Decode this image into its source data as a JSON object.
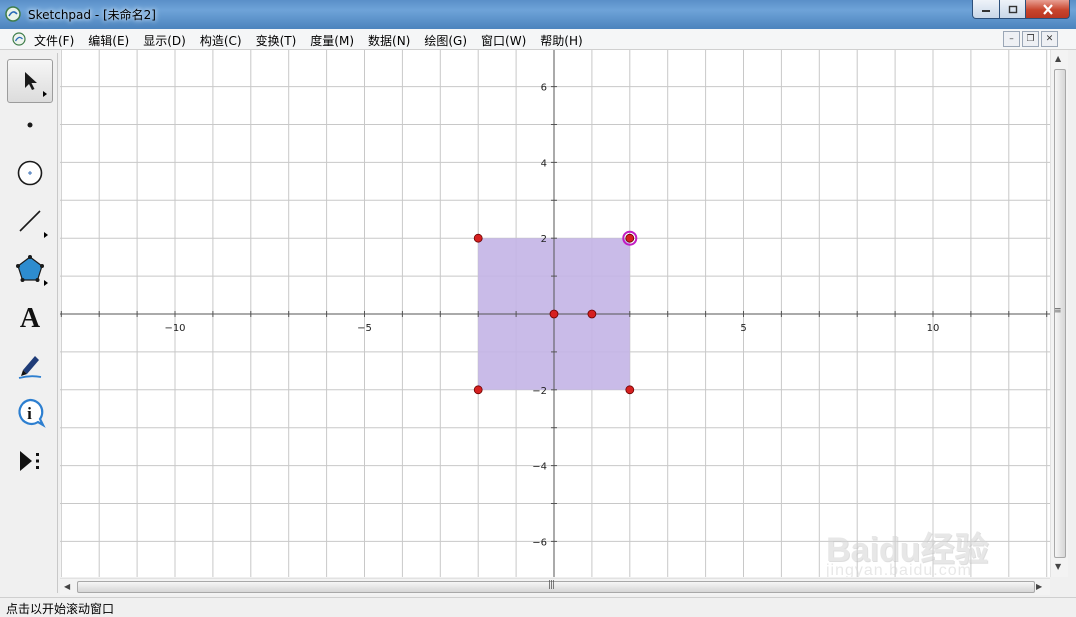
{
  "window": {
    "title": "Sketchpad  - [未命名2]"
  },
  "menu": {
    "items": [
      {
        "label": "文件(F)"
      },
      {
        "label": "编辑(E)"
      },
      {
        "label": "显示(D)"
      },
      {
        "label": "构造(C)"
      },
      {
        "label": "变换(T)"
      },
      {
        "label": "度量(M)"
      },
      {
        "label": "数据(N)"
      },
      {
        "label": "绘图(G)"
      },
      {
        "label": "窗口(W)"
      },
      {
        "label": "帮助(H)"
      }
    ]
  },
  "toolbox": {
    "tools": [
      {
        "name": "arrow-tool",
        "icon": "arrow-select-icon",
        "selected": true
      },
      {
        "name": "point-tool",
        "icon": "point-icon",
        "selected": false
      },
      {
        "name": "compass-tool",
        "icon": "circle-icon",
        "selected": false
      },
      {
        "name": "straightedge-tool",
        "icon": "line-segment-icon",
        "selected": false
      },
      {
        "name": "polygon-tool",
        "icon": "pentagon-icon",
        "selected": false
      },
      {
        "name": "text-tool",
        "icon": "text-a-icon",
        "selected": false
      },
      {
        "name": "marker-tool",
        "icon": "marker-pen-icon",
        "selected": false
      },
      {
        "name": "information-tool",
        "icon": "info-icon",
        "selected": false
      },
      {
        "name": "custom-tool",
        "icon": "play-custom-icon",
        "selected": false
      }
    ]
  },
  "graph": {
    "x_range": [
      -13,
      13
    ],
    "y_range": [
      -7,
      7
    ],
    "x_tick_labels": [
      {
        "value": -10,
        "label": "−10"
      },
      {
        "value": -5,
        "label": "−5"
      },
      {
        "value": 5,
        "label": "5"
      },
      {
        "value": 10,
        "label": "10"
      }
    ],
    "y_tick_labels": [
      {
        "value": 6,
        "label": "6"
      },
      {
        "value": 4,
        "label": "4"
      },
      {
        "value": 2,
        "label": "2"
      },
      {
        "value": -2,
        "label": "−2"
      },
      {
        "value": -4,
        "label": "−4"
      },
      {
        "value": -6,
        "label": "−6"
      }
    ],
    "polygon": {
      "vertices": [
        [
          -2,
          2
        ],
        [
          2,
          2
        ],
        [
          2,
          -2
        ],
        [
          -2,
          -2
        ]
      ],
      "fill_color": "#c3b4e6"
    },
    "points": [
      {
        "x": -2,
        "y": 2,
        "highlighted": false
      },
      {
        "x": 2,
        "y": 2,
        "highlighted": true
      },
      {
        "x": 2,
        "y": -2,
        "highlighted": false
      },
      {
        "x": -2,
        "y": -2,
        "highlighted": false
      },
      {
        "x": 0,
        "y": 0,
        "highlighted": false
      },
      {
        "x": 1,
        "y": 0,
        "highlighted": false
      }
    ],
    "point_color": "#d62020",
    "highlight_color": "#c21cc2",
    "grid_color": "#c8c8c8",
    "axis_color": "#555555"
  },
  "status": {
    "text": "点击以开始滚动窗口"
  },
  "watermark": {
    "brand": "Baidu经验",
    "url": "jingyan.baidu.com"
  }
}
